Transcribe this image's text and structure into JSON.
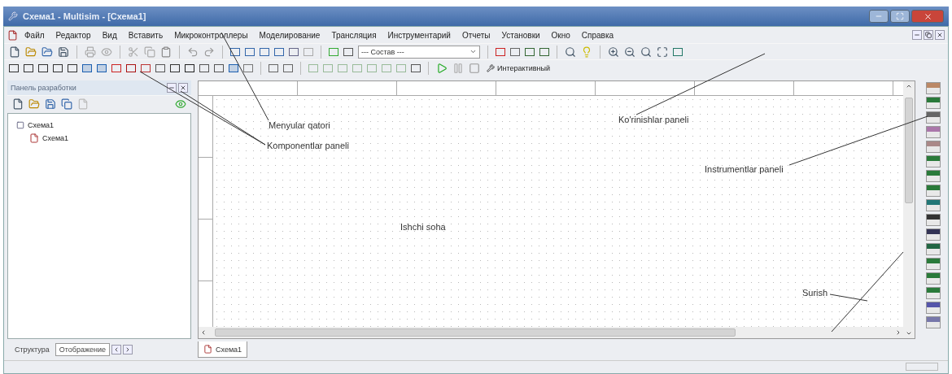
{
  "window": {
    "title": "Схема1 - Multisim - [Схема1]"
  },
  "menu": [
    "Файл",
    "Редактор",
    "Вид",
    "Вставить",
    "Микроконтроллеры",
    "Моделирование",
    "Трансляция",
    "Инструментарий",
    "Отчеты",
    "Установки",
    "Окно",
    "Справка"
  ],
  "toolbar": {
    "dropdown": "--- Состав ---",
    "mode": "Интерактивный"
  },
  "design_panel": {
    "title": "Панель разработки",
    "tree": [
      {
        "label": "Схема1",
        "children": [
          {
            "label": "Схема1"
          }
        ]
      }
    ],
    "tabs": [
      {
        "label": "Структура",
        "selected": false
      },
      {
        "label": "Отображение",
        "selected": true
      }
    ]
  },
  "document_tabs": [
    {
      "label": "Схема1",
      "selected": true
    }
  ],
  "annotations": [
    {
      "text": "Menyular qatori",
      "kind": "menu"
    },
    {
      "text": "Komponentlar paneli",
      "kind": "components"
    },
    {
      "text": "Ko'rinishlar paneli",
      "kind": "views"
    },
    {
      "text": "Instrumentlar paneli",
      "kind": "instruments"
    },
    {
      "text": "Ishchi soha",
      "kind": "workspace"
    },
    {
      "text": "Surish",
      "kind": "scroll"
    }
  ]
}
